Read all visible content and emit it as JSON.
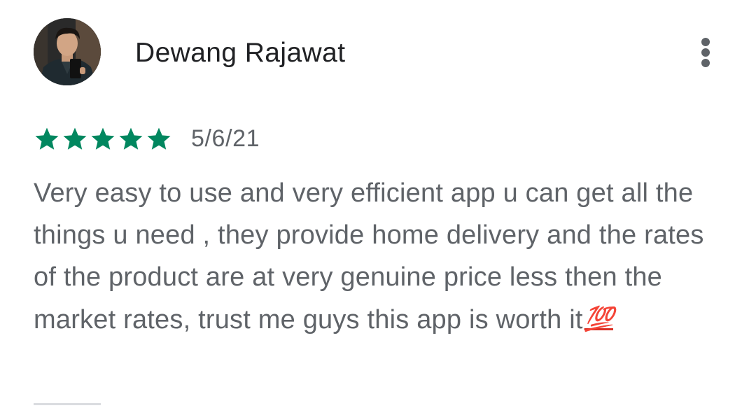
{
  "review": {
    "author_name": "Dewang Rajawat",
    "rating": 5,
    "rating_max": 5,
    "date": "5/6/21",
    "text": "Very easy to use and very efficient app u can get all the things u need , they provide home delivery and the rates of the product are at very genuine price less then the market rates, trust me guys this app is worth it",
    "emoji": "💯"
  },
  "icons": {
    "star": "star-icon",
    "menu": "more-vert-icon"
  },
  "colors": {
    "star_fill": "#01875f",
    "name_text": "#202124",
    "secondary_text": "#5f6368",
    "emoji_red": "#d93025",
    "divider": "#dadce0"
  }
}
